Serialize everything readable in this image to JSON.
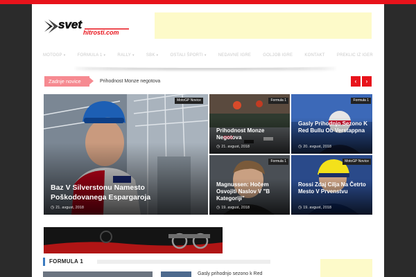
{
  "header": {
    "logo_text": "svet hitrosti.com"
  },
  "nav": {
    "items": [
      {
        "label": "MOTOGP",
        "has_dropdown": true
      },
      {
        "label": "FORMULA 1",
        "has_dropdown": true
      },
      {
        "label": "RALLY",
        "has_dropdown": true
      },
      {
        "label": "SBK",
        "has_dropdown": true
      },
      {
        "label": "OSTALI ŠPORTI",
        "has_dropdown": true
      },
      {
        "label": "NEDAVNE IGRE",
        "has_dropdown": false
      },
      {
        "label": "GOLJOB IGRE",
        "has_dropdown": false
      },
      {
        "label": "KONTAKT",
        "has_dropdown": false
      },
      {
        "label": "PREKLIC IZ IGER",
        "has_dropdown": false
      }
    ]
  },
  "ticker": {
    "label": "Zadnje novice",
    "headline": "Prihodnost Monze negotova",
    "prev_icon": "chevron-left-icon",
    "next_icon": "chevron-right-icon",
    "prev_glyph": "‹",
    "next_glyph": "›"
  },
  "featured": {
    "clock_glyph": "◷",
    "big": {
      "category": "",
      "title": "Baz V Silverstonu Namesto Poškodovanega Espargaroja",
      "date": "21. avgust, 2018"
    },
    "tiles": [
      {
        "category": "MotoGP Novice",
        "title": "",
        "date": ""
      },
      {
        "category": "Formula 1",
        "title": "Prihodnost Monze Negotova",
        "date": "21. avgust, 2018"
      },
      {
        "category": "Formula 1",
        "title": "Gasly Prihodnjo Sezono K Red Bullu Ob Verstappna",
        "date": "20. avgust, 2018"
      },
      {
        "category": "Formula 1",
        "title": "Magnussen: Hočem Osvojiti Naslov V \"B Kategoriji\"",
        "date": "19. avgust, 2018"
      },
      {
        "category": "MotoGP Novice",
        "title": "Rossi Zdaj Cilja Na Četrto Mesto V Prvenstvu",
        "date": "19. avgust, 2018"
      }
    ]
  },
  "section": {
    "title": "FORMULA 1",
    "first_link": "Gasly prihodnjo sezono k Red"
  },
  "colors": {
    "accent": "#e8131b",
    "ticker_label": "#f68a91",
    "ad_placeholder": "#fdfac9",
    "section_marker": "#3a7ac0"
  }
}
